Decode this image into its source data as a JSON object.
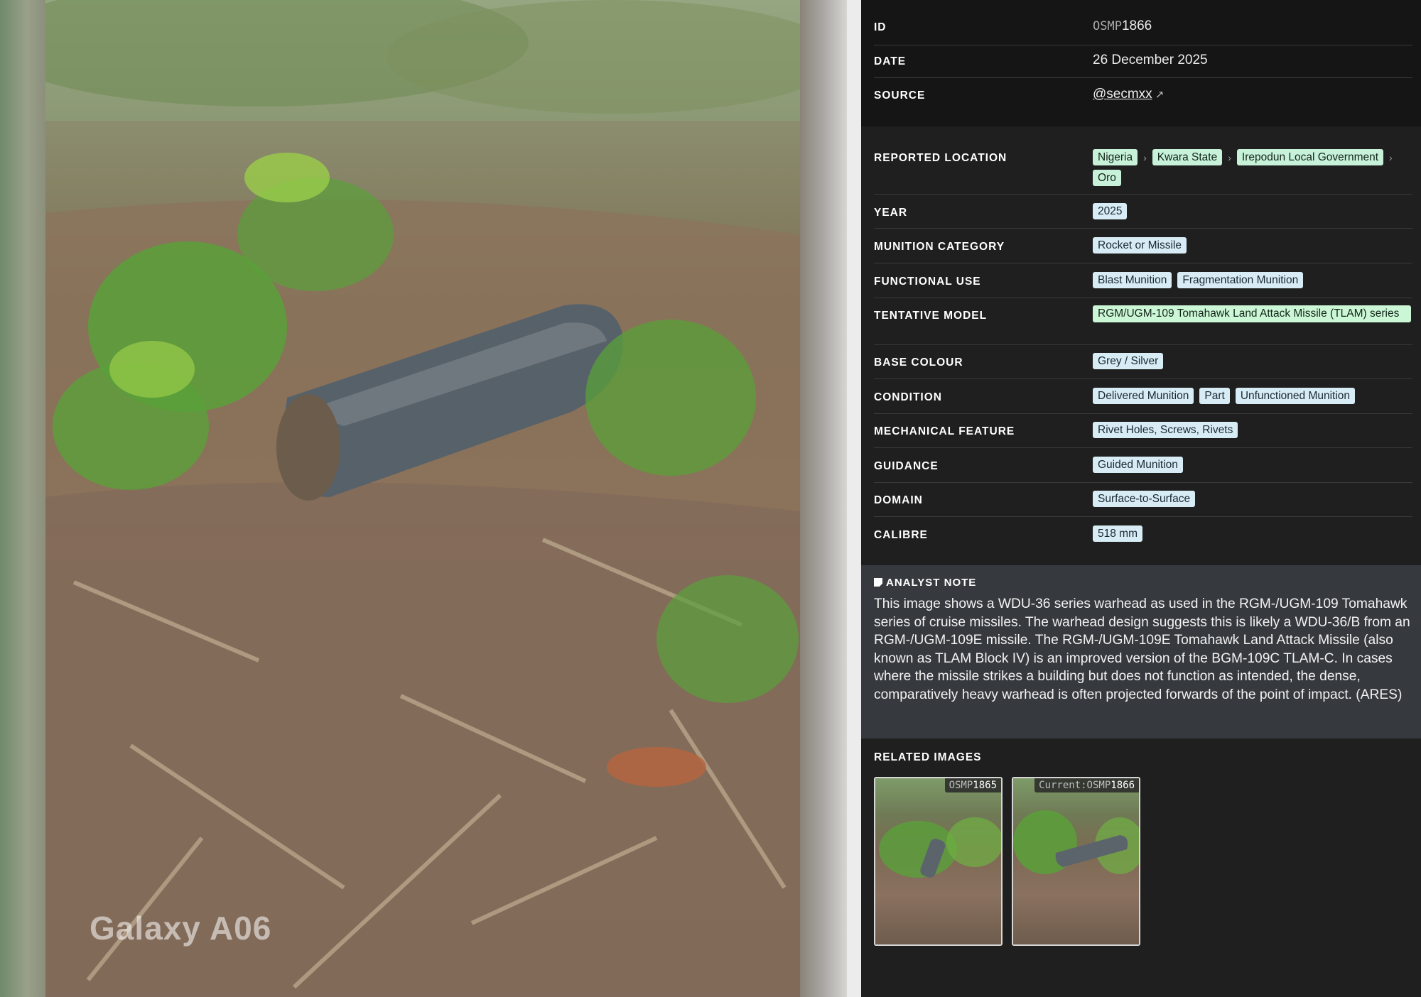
{
  "photo": {
    "watermark": "Galaxy A06"
  },
  "record": {
    "id_label": "ID",
    "id_prefix": "OSMP",
    "id_number": "1866",
    "date_label": "DATE",
    "date_value": "26 December 2025",
    "source_label": "SOURCE",
    "source_value": "@secmxx",
    "source_ext_icon": "↗"
  },
  "fields": {
    "location_label": "REPORTED LOCATION",
    "location": [
      "Nigeria",
      "Kwara State",
      "Irepodun Local Government",
      "Oro"
    ],
    "year_label": "YEAR",
    "year": "2025",
    "category_label": "MUNITION CATEGORY",
    "category": "Rocket or Missile",
    "functional_label": "FUNCTIONAL USE",
    "functional": [
      "Blast Munition",
      "Fragmentation Munition"
    ],
    "model_label": "TENTATIVE MODEL",
    "model": "RGM/UGM-109 Tomahawk Land Attack Missile (TLAM) series",
    "colour_label": "BASE COLOUR",
    "colour": "Grey / Silver",
    "condition_label": "CONDITION",
    "condition": [
      "Delivered Munition",
      "Part",
      "Unfunctioned Munition"
    ],
    "mechanical_label": "MECHANICAL FEATURE",
    "mechanical": "Rivet Holes, Screws, Rivets",
    "guidance_label": "GUIDANCE",
    "guidance": "Guided Munition",
    "domain_label": "DOMAIN",
    "domain": "Surface-to-Surface",
    "calibre_label": "CALIBRE",
    "calibre": "518 mm",
    "location_sep": "›"
  },
  "note": {
    "title": "ANALYST NOTE",
    "text": "This image shows a WDU-36 series warhead as used in the RGM-/UGM-109 Tomahawk series of cruise missiles. The warhead design suggests this is likely a WDU-36/B from an RGM-/UGM-109E missile. The RGM-/UGM-109E Tomahawk Land Attack Missile (also known as TLAM Block IV) is an improved version of the BGM-109C TLAM-C. In cases where the missile strikes a building but does not function as intended, the dense, comparatively heavy warhead is often projected forwards of the point of impact. (ARES)"
  },
  "related": {
    "title": "RELATED IMAGES",
    "items": [
      {
        "prefix": "OSMP",
        "number": "1865"
      },
      {
        "prefix": "Current:OSMP",
        "number": "1866"
      }
    ]
  }
}
